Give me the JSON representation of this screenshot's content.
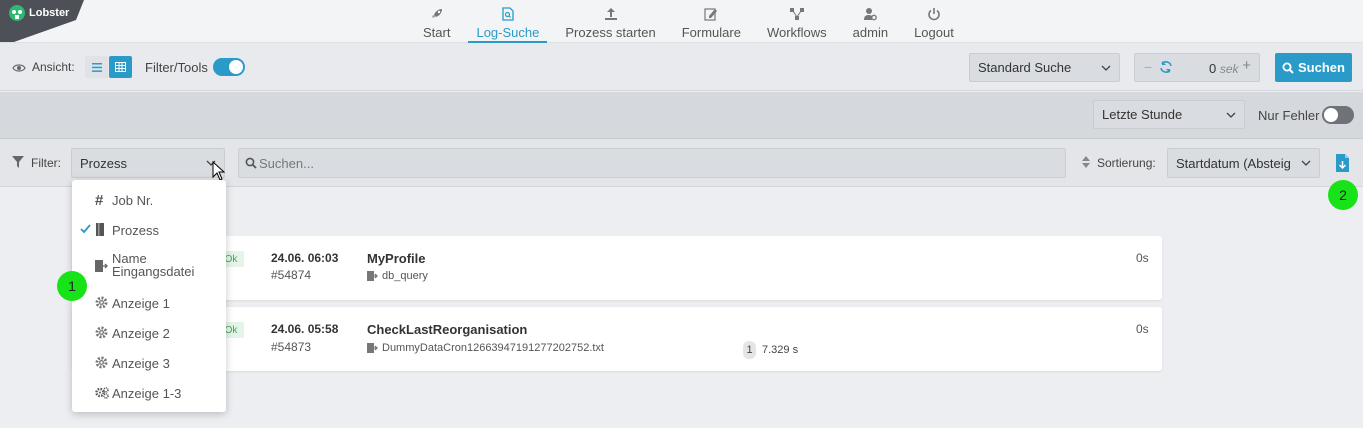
{
  "app": {
    "logo_text": "Lobster"
  },
  "nav": {
    "items": [
      {
        "label": "Start",
        "icon": "rocket-icon"
      },
      {
        "label": "Log-Suche",
        "icon": "file-search-icon",
        "active": true
      },
      {
        "label": "Prozess starten",
        "icon": "upload-icon"
      },
      {
        "label": "Formulare",
        "icon": "pencil-icon"
      },
      {
        "label": "Workflows",
        "icon": "workflow-icon"
      },
      {
        "label": "admin",
        "icon": "user-gear-icon"
      },
      {
        "label": "Logout",
        "icon": "power-icon"
      }
    ]
  },
  "toolbar": {
    "ansicht_label": "Ansicht:",
    "filter_tools_label": "Filter/Tools",
    "filter_tools_on": true,
    "search_mode": "Standard Suche",
    "refresh_value": "0",
    "refresh_unit": "sek",
    "search_button": "Suchen"
  },
  "timerow": {
    "range": "Letzte Stunde",
    "only_errors_label": "Nur Fehler",
    "only_errors_on": false
  },
  "filterrow": {
    "filter_label": "Filter:",
    "filter_field": "Prozess",
    "search_placeholder": "Suchen...",
    "sort_label": "Sortierung:",
    "sort_value": "Startdatum (Absteig"
  },
  "dropdown": {
    "items": [
      {
        "label": "Job Nr.",
        "icon": "hash-icon",
        "checked": false
      },
      {
        "label": "Prozess",
        "icon": "process-icon",
        "checked": true
      },
      {
        "label": "Name Eingangsdatei",
        "icon": "input-file-icon",
        "checked": false
      },
      {
        "label": "Anzeige 1",
        "icon": "gear-icon",
        "checked": false
      },
      {
        "label": "Anzeige 2",
        "icon": "gear-icon",
        "checked": false
      },
      {
        "label": "Anzeige 3",
        "icon": "gear-icon",
        "checked": false
      },
      {
        "label": "Anzeige 1-3",
        "icon": "gears-icon",
        "checked": false
      }
    ]
  },
  "jobs": [
    {
      "status": "Ok",
      "date": "24.06. 06:03",
      "job": "#54874",
      "name": "MyProfile",
      "sub": "db_query",
      "duration": "0s",
      "count": "",
      "secs": ""
    },
    {
      "status": "Ok",
      "date": "24.06. 05:58",
      "job": "#54873",
      "name": "CheckLastReorganisation",
      "sub": "DummyDataCron12663947191277202752.txt",
      "duration": "0s",
      "count": "1",
      "secs": "7.329 s"
    }
  ],
  "markers": [
    "1",
    "2"
  ],
  "colors": {
    "accent": "#2a9bc9",
    "ok": "#3fa85c",
    "marker": "#18e318"
  }
}
